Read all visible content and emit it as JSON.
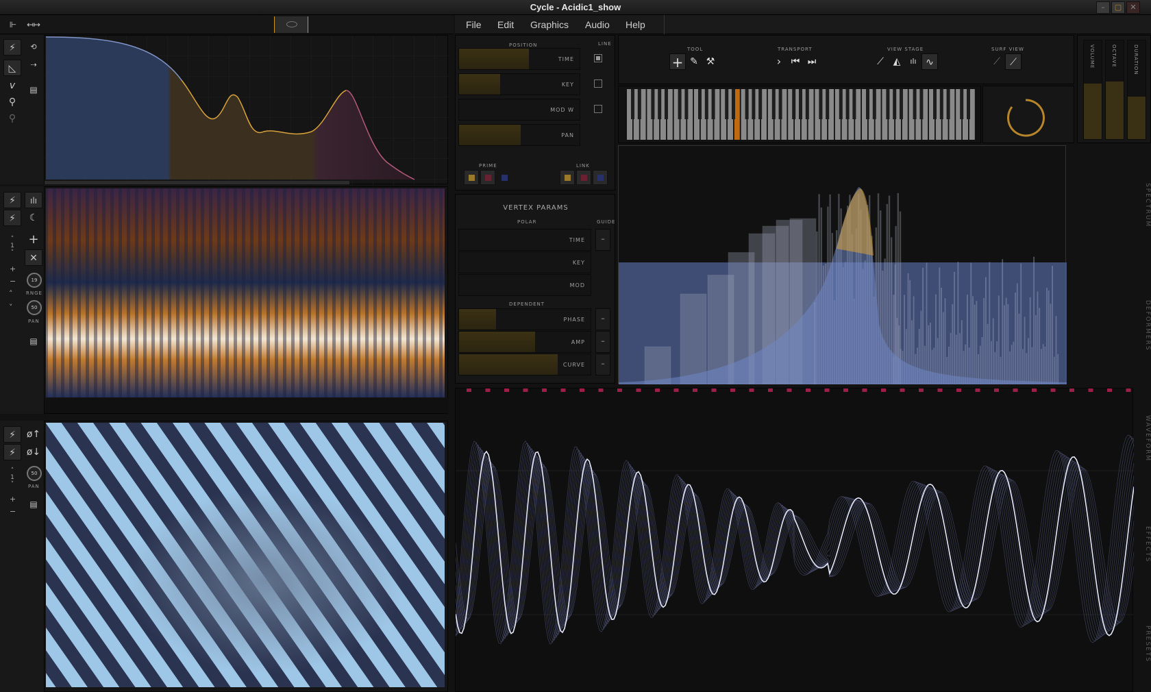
{
  "window": {
    "title": "Cycle - Acidic1_show"
  },
  "menu": {
    "items": [
      "File",
      "Edit",
      "Graphics",
      "Audio",
      "Help"
    ]
  },
  "controls": {
    "position": {
      "header": "POSITION",
      "line_header": "LINE",
      "sliders": [
        {
          "label": "TIME",
          "fill": 0.58,
          "line_checked": true
        },
        {
          "label": "KEY",
          "fill": 0.34,
          "line_checked": false
        },
        {
          "label": "MOD W",
          "fill": 0.0,
          "line_checked": false
        },
        {
          "label": "PAN",
          "fill": 0.51
        }
      ],
      "prime_label": "PRIME",
      "link_label": "LINK"
    },
    "vertex": {
      "title": "VERTEX PARAMS",
      "polar_label": "POLAR",
      "guide_label": "GUIDE",
      "polar": [
        {
          "label": "TIME",
          "fill": 0.0
        },
        {
          "label": "KEY",
          "fill": 0.0
        },
        {
          "label": "MOD",
          "fill": 0.0
        }
      ],
      "dependent_label": "DEPENDENT",
      "dependent": [
        {
          "label": "PHASE",
          "fill": 0.28
        },
        {
          "label": "AMP",
          "fill": 0.58
        },
        {
          "label": "CURVE",
          "fill": 0.75
        }
      ]
    }
  },
  "toolbar": {
    "tool_label": "TOOL",
    "transport_label": "TRANSPORT",
    "viewstage_label": "VIEW STAGE",
    "surfview_label": "SURF VIEW"
  },
  "meters": [
    {
      "label": "VOLUME",
      "level": 0.56
    },
    {
      "label": "OCTAVE",
      "level": 0.58
    },
    {
      "label": "DURATION",
      "level": 0.43
    }
  ],
  "left_panels": {
    "spectro": {
      "range_label": "RNGE",
      "range_value": "19",
      "pan_label": "PAN",
      "pan_value": "50",
      "counter": "1"
    },
    "phase": {
      "pan_label": "PAN",
      "pan_value": "50",
      "counter": "1"
    }
  },
  "side_tabs": {
    "top": [
      "SPECTRUM",
      "DEFORMERS"
    ],
    "bottom": [
      "WAVEFORM",
      "EFFECTS",
      "PRESETS"
    ]
  },
  "colors": {
    "accent": "#c9961e",
    "wave": "#c7cff2",
    "spectrum_blue": "#6f86c4",
    "envelope": "#d9a23a"
  }
}
